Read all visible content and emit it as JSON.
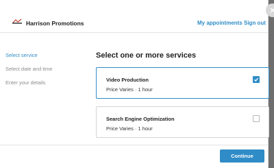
{
  "header": {
    "brand": "Harrison Promotions",
    "appointments_link": "My appointments",
    "signout_link": "Sign out",
    "logo_icon": "harrison-promotions-logo"
  },
  "steps": [
    {
      "label": "Select service",
      "active": true
    },
    {
      "label": "Select date and time",
      "active": false
    },
    {
      "label": "Enter your details",
      "active": false
    }
  ],
  "main": {
    "title": "Select one or more services",
    "services": [
      {
        "name": "Video Production",
        "meta": "Price Varies · 1 hour",
        "selected": true
      },
      {
        "name": "Search Engine Optimization",
        "meta": "Price Varies · 1 hour",
        "selected": false
      }
    ]
  },
  "footer": {
    "continue_label": "Continue"
  },
  "colors": {
    "accent": "#2f8cc7",
    "overlay": "#6e6e6e"
  },
  "icons": {
    "close": "close-icon",
    "check": "check-icon"
  }
}
